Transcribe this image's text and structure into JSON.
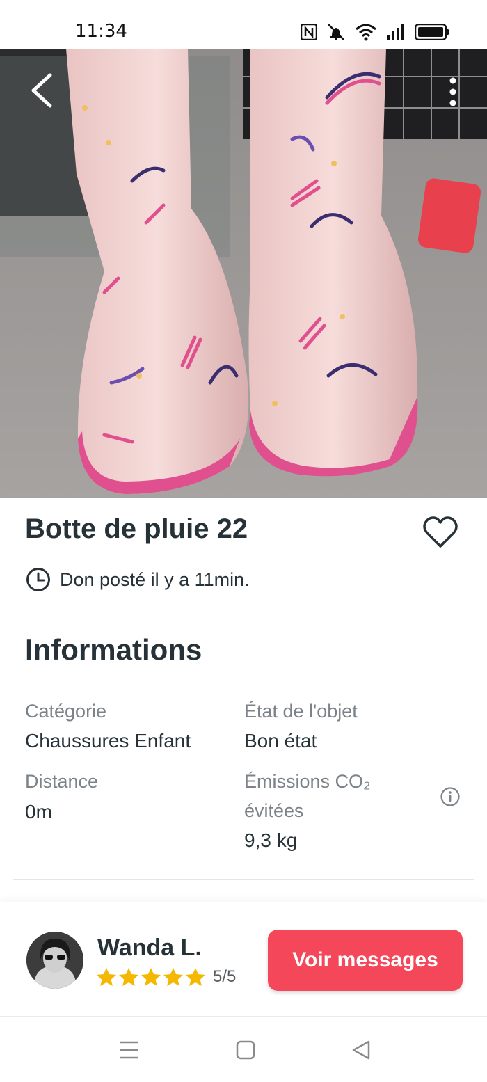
{
  "status_bar": {
    "time": "11:34",
    "icons": [
      "nfc-icon",
      "mute-icon",
      "wifi-icon",
      "signal-icon",
      "battery-icon"
    ]
  },
  "photo": {
    "description_icon": "rain-boots-photo",
    "back_icon": "chevron-left-icon",
    "menu_icon": "more-vertical-icon"
  },
  "listing": {
    "title": "Botte de pluie 22",
    "posted": "Don posté il y a 11min.",
    "favorite_icon": "heart-icon"
  },
  "informations": {
    "heading": "Informations",
    "category_label": "Catégorie",
    "category_value": "Chaussures Enfant",
    "condition_label": "État de l'objet",
    "condition_value": "Bon état",
    "distance_label": "Distance",
    "distance_value": "0m",
    "emissions_label_line1": "Émissions CO₂",
    "emissions_label_line2": "évitées",
    "emissions_value": "9,3 kg"
  },
  "seller": {
    "name": "Wanda L.",
    "rating": "5/5",
    "stars": 5,
    "star_color": "#f5b800"
  },
  "actions": {
    "messages_button": "Voir messages",
    "accent_color": "#f4475a"
  },
  "nav": {
    "menu_icon": "menu-icon",
    "home_icon": "square-icon",
    "back_icon": "triangle-back-icon"
  }
}
